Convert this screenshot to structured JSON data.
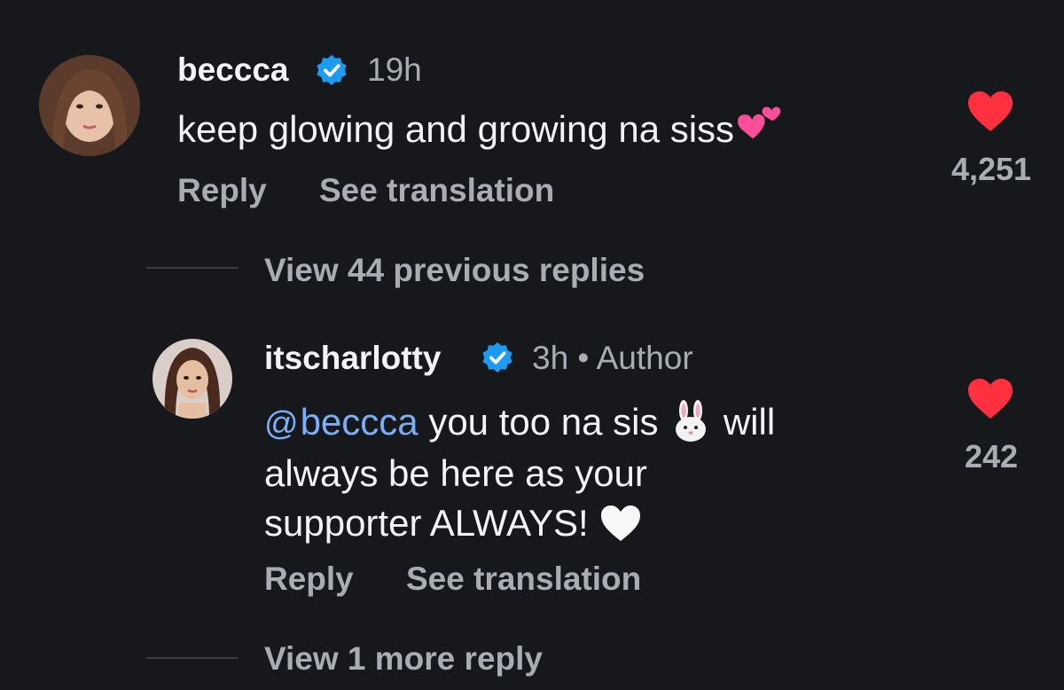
{
  "colors": {
    "background": "#16181c",
    "text_primary": "#f2f3f5",
    "text_secondary": "#a9adb3",
    "mention": "#7aaef5",
    "verified_badge": "#1d9bf0",
    "like_heart": "#ff3040"
  },
  "comment": {
    "username": "beccca",
    "time": "19h",
    "text": "keep glowing and growing na siss",
    "emoji": "two-hearts",
    "reply_label": "Reply",
    "translate_label": "See translation",
    "like_count": "4,251"
  },
  "thread": {
    "view_previous": "View 44 previous replies",
    "view_more": "View 1 more reply"
  },
  "reply": {
    "username": "itscharlotty",
    "meta": "3h • Author",
    "mention": "beccca",
    "text_part1": " you too na sis ",
    "text_part2": " will",
    "text_line2": "always be here as your",
    "text_line3": "supporter ALWAYS! ",
    "emoji_rabbit": "rabbit-face",
    "emoji_heart": "white-heart",
    "reply_label": "Reply",
    "translate_label": "See translation",
    "like_count": "242"
  }
}
